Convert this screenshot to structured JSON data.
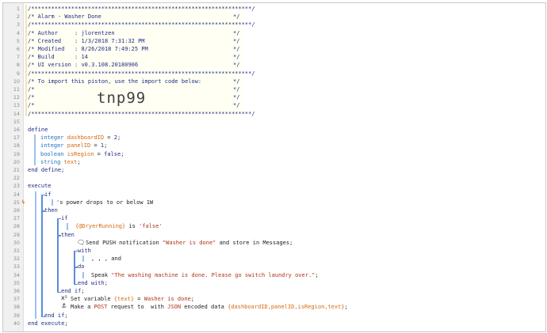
{
  "editor": {
    "line_numbers": [
      "1",
      "2",
      "3",
      "4",
      "5",
      "6",
      "7",
      "8",
      "9",
      "10",
      "11",
      "12",
      "13",
      "14",
      "15",
      "16",
      "17",
      "18",
      "19",
      "20",
      "21",
      "22",
      "23",
      "24",
      "25",
      "26",
      "27",
      "28",
      "29",
      "30",
      "31",
      "32",
      "33",
      "34",
      "35",
      "36",
      "37",
      "38",
      "39",
      "40"
    ],
    "header": {
      "stars": "/******************************************************************/",
      "title_prefix": "/* ",
      "title": "Alarm - Washer Done",
      "close": "*/",
      "author_label": "/* Author     : ",
      "author": "jlorentzen",
      "created_label": "/* Created    : ",
      "created": "1/3/2018 7:31:32 PM",
      "modified_label": "/* Modified   : ",
      "modified": "8/26/2018 7:49:25 PM",
      "build_label": "/* Build      : ",
      "build": "14",
      "ui_label": "/* UI version : ",
      "ui_version": "v0.3.108.20180906",
      "import_text": "/* To import this piston, use the import code below:",
      "slash_star": "/*",
      "import_code": "tnp99"
    },
    "define": {
      "keyword": "define",
      "vars": [
        {
          "type": "integer",
          "name": "dashboardID",
          "op": " = ",
          "value": "2",
          "end": ";"
        },
        {
          "type": "integer",
          "name": "panelID",
          "op": " = ",
          "value": "1",
          "end": ";"
        },
        {
          "type": "boolean",
          "name": "isRegion",
          "op": " = ",
          "value": "false",
          "end": ";"
        },
        {
          "type": "string",
          "name": "text",
          "op": "",
          "value": "",
          "end": ";"
        }
      ],
      "end": "end define;"
    },
    "execute": {
      "keyword": "execute",
      "if_kw": "if",
      "condition": "'s power drops to or below 1W",
      "then_kw": "then",
      "inner_if_kw": "if",
      "inner_var": "{@DryerRunning}",
      "inner_is": " is ",
      "inner_value": "'false'",
      "inner_then_kw": "then",
      "push_action": "Send PUSH notification ",
      "push_msg": "\"Washer is done\"",
      "push_tail": " and store in Messages;",
      "with_kw": "with",
      "devices": ", , , and",
      "do_kw": "do",
      "speak_prefix": "Speak ",
      "speak_msg": "\"The washing machine is done. Please go switch laundry over.\"",
      "speak_end": ";",
      "end_with": "end with;",
      "end_if_inner": "end if;",
      "set_var_prefix": "Set variable ",
      "set_var_name": "{text}",
      "set_var_eq": " = ",
      "set_var_value": "Washer is done",
      "set_var_end": ";",
      "post_prefix": "Make a ",
      "post_method": "POST",
      "post_mid": " request to  with ",
      "post_format": "JSON",
      "post_mid2": " encoded data ",
      "post_data": "{dashboardID,panelID,isRegion,text}",
      "post_end": ";",
      "end_if_outer": "end if;",
      "end": "end execute;"
    },
    "icons": {
      "trigger": "lightning-icon",
      "push": "message-icon",
      "set_var": "variable-icon",
      "http": "anchor-icon"
    }
  }
}
